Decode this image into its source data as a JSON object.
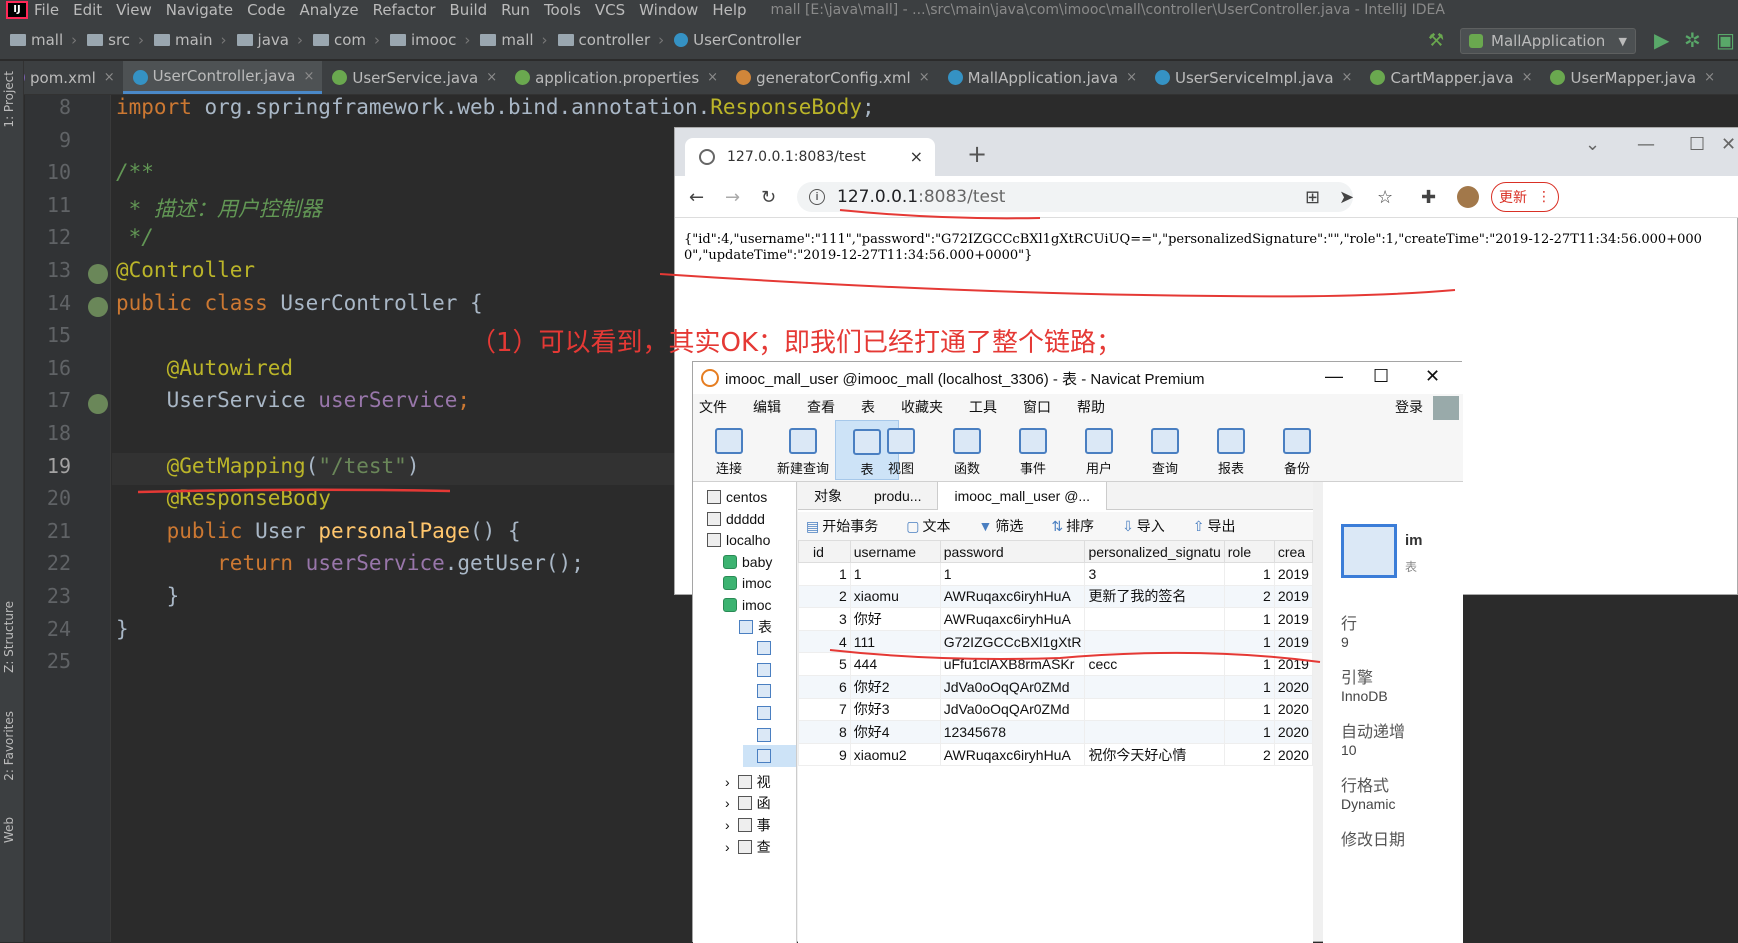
{
  "ide": {
    "logo": "IJ",
    "menu": [
      "File",
      "Edit",
      "View",
      "Navigate",
      "Code",
      "Analyze",
      "Refactor",
      "Build",
      "Run",
      "Tools",
      "VCS",
      "Window",
      "Help"
    ],
    "window_title": "mall [E:\\java\\mall] - ...\\src\\main\\java\\com\\imooc\\mall\\controller\\UserController.java - IntelliJ IDEA",
    "breadcrumbs": [
      "mall",
      "src",
      "main",
      "java",
      "com",
      "imooc",
      "mall",
      "controller",
      "UserController"
    ],
    "run_config": "MallApplication",
    "tabs": [
      {
        "label": "pom.xml",
        "color": "#7a5fb1",
        "active": false
      },
      {
        "label": "UserController.java",
        "color": "#3592c4",
        "active": true
      },
      {
        "label": "UserService.java",
        "color": "#6aa84f",
        "active": false
      },
      {
        "label": "application.properties",
        "color": "#6aa84f",
        "active": false
      },
      {
        "label": "generatorConfig.xml",
        "color": "#d0863a",
        "active": false
      },
      {
        "label": "MallApplication.java",
        "color": "#3592c4",
        "active": false
      },
      {
        "label": "UserServiceImpl.java",
        "color": "#3592c4",
        "active": false
      },
      {
        "label": "CartMapper.java",
        "color": "#6aa84f",
        "active": false
      },
      {
        "label": "UserMapper.java",
        "color": "#6aa84f",
        "active": false
      }
    ],
    "tab_close": "×",
    "left_tools": [
      "1: Project",
      "Z: Structure",
      "2: Favorites",
      "Web"
    ],
    "line_numbers": [
      "8",
      "9",
      "10",
      "11",
      "12",
      "13",
      "14",
      "15",
      "16",
      "17",
      "18",
      "19",
      "20",
      "21",
      "22",
      "23",
      "24",
      "25"
    ],
    "current_line": "19"
  },
  "code": [
    [
      [
        "kw",
        "import "
      ],
      [
        "p",
        "org.springframework.web.bind.annotation."
      ],
      [
        "ann",
        "ResponseBody"
      ],
      [
        "p",
        ";"
      ]
    ],
    [],
    [
      [
        "cm",
        "/**"
      ]
    ],
    [
      [
        "cm",
        " * 描述：用户控制器"
      ]
    ],
    [
      [
        "cm",
        " */"
      ]
    ],
    [
      [
        "ann",
        "@Controller"
      ]
    ],
    [
      [
        "kw",
        "public class "
      ],
      [
        "p",
        "UserController {"
      ]
    ],
    [],
    [
      [
        "p",
        "    "
      ],
      [
        "ann",
        "@Autowired"
      ]
    ],
    [
      [
        "p",
        "    UserService "
      ],
      [
        "fld",
        "userService"
      ],
      [
        "kw",
        ";"
      ]
    ],
    [],
    [
      [
        "p",
        "    "
      ],
      [
        "ann",
        "@GetMapping"
      ],
      [
        "p",
        "("
      ],
      [
        "str",
        "\"/test\""
      ],
      [
        "p",
        ")"
      ]
    ],
    [
      [
        "p",
        "    "
      ],
      [
        "ann",
        "@ResponseBody"
      ]
    ],
    [
      [
        "p",
        "    "
      ],
      [
        "kw",
        "public "
      ],
      [
        "p",
        "User "
      ],
      [
        "fn",
        "personalPage"
      ],
      [
        "p",
        "() {"
      ]
    ],
    [
      [
        "p",
        "        "
      ],
      [
        "kw",
        "return "
      ],
      [
        "fld",
        "userService"
      ],
      [
        "p",
        "."
      ],
      [
        "p",
        "getUser();"
      ]
    ],
    [
      [
        "p",
        "    }"
      ]
    ],
    [
      [
        "p",
        "}"
      ]
    ],
    []
  ],
  "browser": {
    "tab_title": "127.0.0.1:8083/test",
    "tab_close": "×",
    "new_tab": "+",
    "url_host": "127.0.0.1",
    "url_rest": ":8083/test",
    "update_btn": "更新",
    "json_text": "{\"id\":4,\"username\":\"111\",\"password\":\"G72IZGCCcBXl1gXtRCUiUQ==\",\"personalizedSignature\":\"\",\"role\":1,\"createTime\":\"2019-12-27T11:34:56.000+0000\",\"updateTime\":\"2019-12-27T11:34:56.000+0000\"}"
  },
  "annotation": {
    "note": "（1）可以看到，其实OK；即我们已经打通了整个链路；",
    "color": "#e53935"
  },
  "navicat": {
    "title": "imooc_mall_user @imooc_mall (localhost_3306) - 表 - Navicat Premium",
    "menu": [
      "文件",
      "编辑",
      "查看",
      "表",
      "收藏夹",
      "工具",
      "窗口",
      "帮助"
    ],
    "login": "登录",
    "toolbar": [
      "连接",
      "新建查询",
      "表",
      "视图",
      "函数",
      "事件",
      "用户",
      "查询",
      "报表",
      "备份"
    ],
    "tree": [
      {
        "label": "centos",
        "indent": 0,
        "type": "conn"
      },
      {
        "label": "ddddd",
        "indent": 0,
        "type": "conn"
      },
      {
        "label": "localho",
        "indent": 0,
        "type": "conn"
      },
      {
        "label": "baby",
        "indent": 1,
        "type": "db"
      },
      {
        "label": "imoc",
        "indent": 1,
        "type": "db"
      },
      {
        "label": "imoc",
        "indent": 1,
        "type": "db"
      },
      {
        "label": "表",
        "indent": 2,
        "type": "tbl"
      }
    ],
    "tree_bottom": [
      "视",
      "函",
      "事",
      "查"
    ],
    "obj_tabs": [
      "对象",
      "produ...",
      "imooc_mall_user @..."
    ],
    "obj_toolbar": [
      "开始事务",
      "文本",
      "筛选",
      "排序",
      "导入",
      "导出"
    ],
    "columns": [
      "id",
      "username",
      "password",
      "personalized_signatu",
      "role",
      "crea"
    ],
    "rows": [
      [
        "1",
        "1",
        "1",
        "3",
        "1",
        "2019"
      ],
      [
        "2",
        "xiaomu",
        "AWRuqaxc6iryhHuA",
        "更新了我的签名",
        "2",
        "2019"
      ],
      [
        "3",
        "你好",
        "AWRuqaxc6iryhHuA",
        "",
        "1",
        "2019"
      ],
      [
        "4",
        "111",
        "G72IZGCCcBXl1gXtR",
        "",
        "1",
        "2019"
      ],
      [
        "5",
        "444",
        "uFfu1clAXB8rmASKr",
        "cecc",
        "1",
        "2019"
      ],
      [
        "6",
        "你好2",
        "JdVa0oOqQAr0ZMd",
        "",
        "1",
        "2020"
      ],
      [
        "7",
        "你好3",
        "JdVa0oOqQAr0ZMd",
        "",
        "1",
        "2020"
      ],
      [
        "8",
        "你好4",
        "12345678",
        "",
        "1",
        "2020"
      ],
      [
        "9",
        "xiaomu2",
        "AWRuqaxc6iryhHuA",
        "祝你今天好心情",
        "2",
        "2020"
      ]
    ],
    "info": {
      "name": "im",
      "sub": "表",
      "rows_label": "行",
      "rows_value": "9",
      "engine_label": "引擎",
      "engine_value": "InnoDB",
      "ai_label": "自动递增",
      "ai_value": "10",
      "fmt_label": "行格式",
      "fmt_value": "Dynamic",
      "mod_label": "修改日期"
    }
  }
}
